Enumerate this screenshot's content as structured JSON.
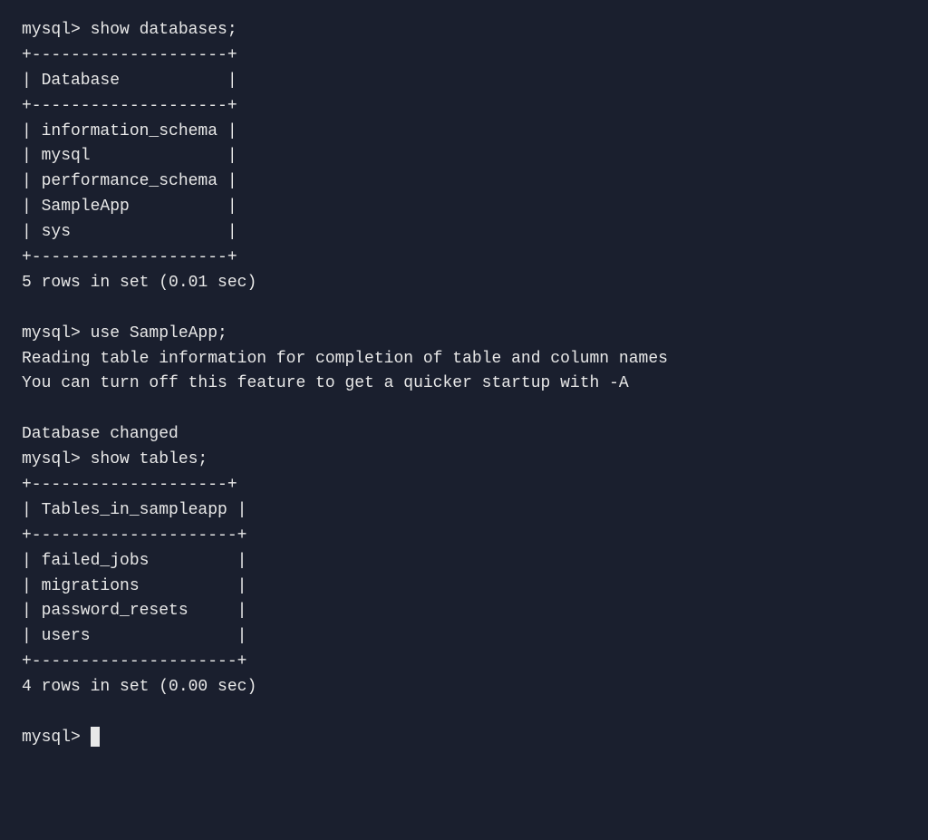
{
  "terminal": {
    "lines": [
      {
        "id": "l1",
        "text": "mysql> show databases;"
      },
      {
        "id": "l2",
        "text": "+--------------------+"
      },
      {
        "id": "l3",
        "text": "| Database           |"
      },
      {
        "id": "l4",
        "text": "+--------------------+"
      },
      {
        "id": "l5",
        "text": "| information_schema |"
      },
      {
        "id": "l6",
        "text": "| mysql              |"
      },
      {
        "id": "l7",
        "text": "| performance_schema |"
      },
      {
        "id": "l8",
        "text": "| SampleApp          |"
      },
      {
        "id": "l9",
        "text": "| sys                |"
      },
      {
        "id": "l10",
        "text": "+--------------------+"
      },
      {
        "id": "l11",
        "text": "5 rows in set (0.01 sec)"
      },
      {
        "id": "blank1",
        "text": ""
      },
      {
        "id": "l12",
        "text": "mysql> use SampleApp;"
      },
      {
        "id": "l13",
        "text": "Reading table information for completion of table and column names"
      },
      {
        "id": "l14",
        "text": "You can turn off this feature to get a quicker startup with -A"
      },
      {
        "id": "blank2",
        "text": ""
      },
      {
        "id": "l15",
        "text": "Database changed"
      },
      {
        "id": "l16",
        "text": "mysql> show tables;"
      },
      {
        "id": "l17",
        "text": "+--------------------+"
      },
      {
        "id": "l18",
        "text": "| Tables_in_sampleapp |"
      },
      {
        "id": "l19",
        "text": "+---------------------+"
      },
      {
        "id": "l20",
        "text": "| failed_jobs         |"
      },
      {
        "id": "l21",
        "text": "| migrations          |"
      },
      {
        "id": "l22",
        "text": "| password_resets     |"
      },
      {
        "id": "l23",
        "text": "| users               |"
      },
      {
        "id": "l24",
        "text": "+---------------------+"
      },
      {
        "id": "l25",
        "text": "4 rows in set (0.00 sec)"
      },
      {
        "id": "blank3",
        "text": ""
      },
      {
        "id": "l26",
        "text": "mysql> "
      }
    ],
    "prompt_label": "mysql> "
  }
}
